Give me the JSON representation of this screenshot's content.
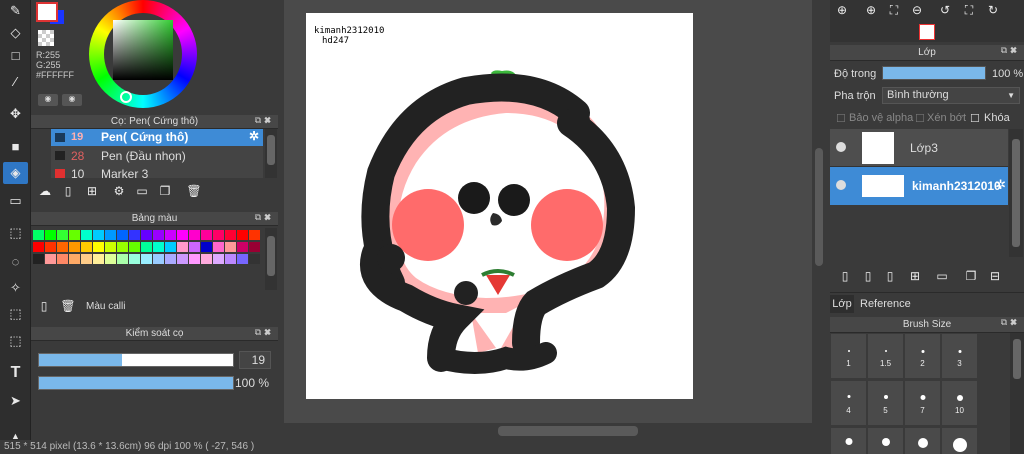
{
  "color_panel": {
    "r": "R:255",
    "g": "G:255",
    "hex": "#FFFFFF"
  },
  "brush_panel": {
    "title": "Cọ: Pen( Cứng thô)",
    "items": [
      {
        "size": "19",
        "name": "Pen( Cứng thô)",
        "color": "#4a8fd6"
      },
      {
        "size": "28",
        "name": "Pen (Đầu nhọn)",
        "color": "#e05050"
      },
      {
        "size": "10",
        "name": "Marker 3",
        "color": "#e05050"
      }
    ]
  },
  "palette_panel": {
    "title": "Bảng màu",
    "label": "Màu calli"
  },
  "brush_control": {
    "title": "Kiểm soát cọ",
    "size": "19",
    "opacity": "100 %",
    "size_fill": 0.43,
    "opacity_fill": 1.0
  },
  "canvas": {
    "watermark_line1": "kimanh2312010",
    "watermark_line2": "hd247"
  },
  "layer_panel": {
    "title": "Lớp",
    "opacity_label": "Độ trong",
    "opacity_value": "100 %",
    "blend_label": "Pha trộn",
    "blend_value": "Bình thường",
    "protect_alpha": "Bảo vệ alpha",
    "clip": "Xén bớt",
    "lock": "Khóa",
    "layers": [
      {
        "name": "Lớp3"
      },
      {
        "name": "kimanh2312010"
      }
    ],
    "tabs": [
      "Lớp",
      "Reference"
    ]
  },
  "brush_size_panel": {
    "title": "Brush Size",
    "sizes": [
      "1",
      "1.5",
      "2",
      "3",
      "4",
      "5",
      "7",
      "10"
    ]
  },
  "status": "515 * 514 pixel   (13.6 * 13.6cm)   96 dpi   100 %   ( -27, 546 )"
}
